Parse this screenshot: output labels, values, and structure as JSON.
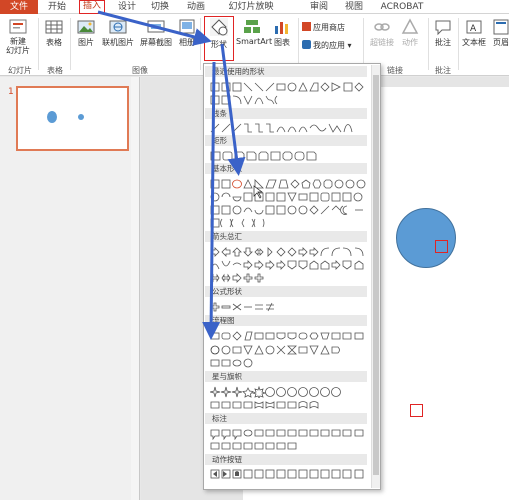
{
  "tabs": {
    "file": "文件",
    "items": [
      {
        "label": "开始",
        "active": false
      },
      {
        "label": "插入",
        "active": true
      },
      {
        "label": "设计",
        "active": false
      },
      {
        "label": "切换",
        "active": false
      },
      {
        "label": "动画",
        "active": false
      },
      {
        "label": "幻灯片放映",
        "active": false
      },
      {
        "label": "审阅",
        "active": false
      },
      {
        "label": "视图",
        "active": false
      },
      {
        "label": "ACROBAT",
        "active": false
      }
    ]
  },
  "ribbon": {
    "new_slide": "新建\n幻灯片",
    "table": "表格",
    "picture": "图片",
    "online_picture": "联机图片",
    "screenshot": "屏幕截图",
    "album": "相册",
    "shapes": "形状",
    "smartart": "SmartArt",
    "chart": "图表",
    "app_store": "应用商店",
    "my_apps": "我的应用",
    "hyperlink": "超链接",
    "action": "动作",
    "comment": "批注",
    "textbox": "文本框",
    "header_footer": "页眉",
    "groups": {
      "slides": "幻灯片",
      "tables": "表格",
      "images": "图像",
      "links": "链接",
      "comments": "批注"
    }
  },
  "slide_panel": {
    "slide_number": "1"
  },
  "gallery": {
    "sections": [
      "最近使用的形状",
      "线条",
      "矩形",
      "基本形状",
      "箭头总汇",
      "公式形状",
      "流程图",
      "星与旗帜",
      "标注",
      "动作按钮"
    ]
  },
  "colors": {
    "accent": "#d24726",
    "highlight": "#e02424",
    "arrow": "#3a62c8",
    "circle_fill": "#5b9bd5"
  }
}
